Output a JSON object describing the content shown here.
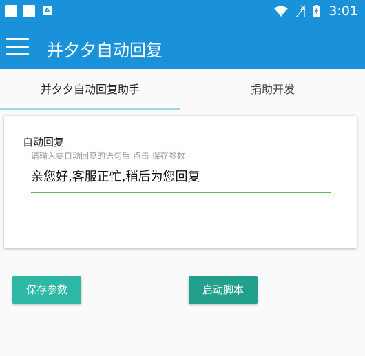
{
  "status_bar": {
    "time": "3:01",
    "icons": [
      "notification-square-icon",
      "notification-square-icon",
      "font-a-icon",
      "wifi-icon",
      "no-sim-icon",
      "battery-icon"
    ]
  },
  "app_bar": {
    "title": "并夕夕自动回复",
    "menu_icon": "hamburger-menu-icon"
  },
  "tabs": [
    {
      "label": "并夕夕自动回复助手",
      "selected": true
    },
    {
      "label": "捐助开发",
      "selected": false
    }
  ],
  "card": {
    "label": "自动回复",
    "hint": "请输入要自动回复的语句后 点击 保存参数",
    "input_value": "亲您好,客服正忙,稍后为您回复"
  },
  "buttons": {
    "save": "保存参数",
    "start": "启动脚本"
  },
  "colors": {
    "primary": "#1a92d9",
    "accent_green": "#5cb85c",
    "button_teal": "#2db7a5",
    "button_teal_dark": "#22a08c"
  }
}
